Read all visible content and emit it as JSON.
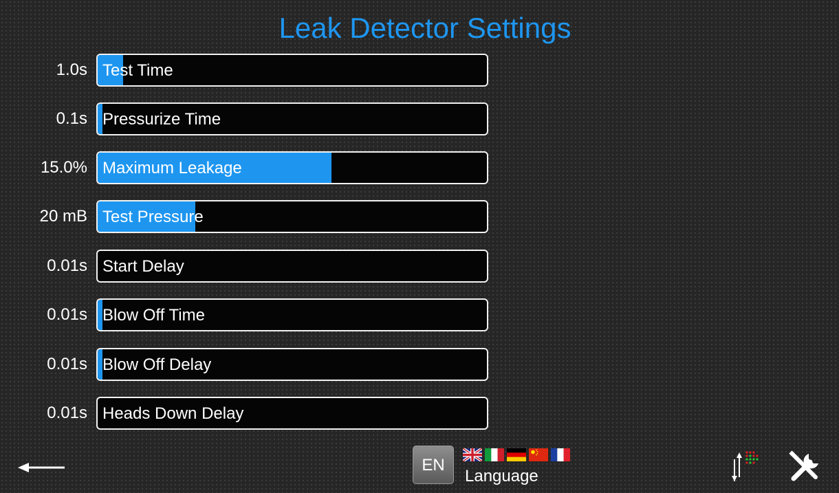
{
  "page": {
    "title": "Leak Detector Settings"
  },
  "settings": [
    {
      "label": "Test Time",
      "value": "1.0s",
      "fill_fraction": 0.066
    },
    {
      "label": "Pressurize Time",
      "value": "0.1s",
      "fill_fraction": 0.012
    },
    {
      "label": "Maximum Leakage",
      "value": "15.0%",
      "fill_fraction": 0.6
    },
    {
      "label": "Test Pressure",
      "value": "20 mB",
      "fill_fraction": 0.25
    },
    {
      "label": "Start Delay",
      "value": "0.01s",
      "fill_fraction": 0.0
    },
    {
      "label": "Blow Off Time",
      "value": "0.01s",
      "fill_fraction": 0.012
    },
    {
      "label": "Blow Off Delay",
      "value": "0.01s",
      "fill_fraction": 0.012
    },
    {
      "label": "Heads Down Delay",
      "value": "0.01s",
      "fill_fraction": 0.0
    }
  ],
  "footer": {
    "language_code": "EN",
    "language_label": "Language",
    "flags": [
      "uk-flag",
      "italy-flag",
      "germany-flag",
      "china-flag",
      "france-flag"
    ]
  },
  "icons": {
    "back": "back-arrow-icon",
    "io": "io-status-icon",
    "tools": "tools-icon"
  },
  "colors": {
    "accent": "#1e96f0",
    "background": "#262626",
    "bar_border": "#f2f2f2"
  }
}
